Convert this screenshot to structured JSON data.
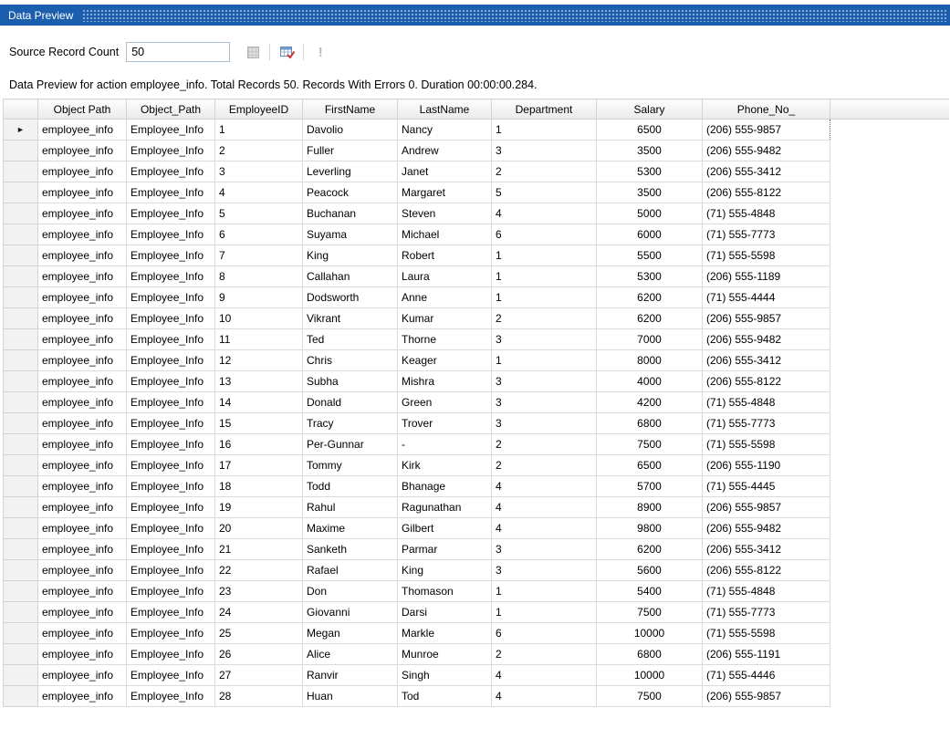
{
  "colors": {
    "titlebar": "#1b5eae",
    "grid_line": "#dcdcdc",
    "header_fill": "#eaeaea"
  },
  "panel": {
    "title": "Data Preview"
  },
  "toolbar": {
    "source_record_count_label": "Source Record Count",
    "source_record_count_value": "50"
  },
  "icons": {
    "current_row_marker": "►",
    "errors_glyph": "!"
  },
  "status": {
    "text": "Data Preview for action employee_info. Total Records 50. Records With Errors 0. Duration 00:00:00.284."
  },
  "table": {
    "columns": [
      "Object Path",
      "Object_Path",
      "EmployeeID",
      "FirstName",
      "LastName",
      "Department",
      "Salary",
      "Phone_No_"
    ],
    "rows": [
      [
        "employee_info",
        "Employee_Info",
        "1",
        "Davolio",
        "Nancy",
        "1",
        "6500",
        "(206) 555-9857"
      ],
      [
        "employee_info",
        "Employee_Info",
        "2",
        "Fuller",
        "Andrew",
        "3",
        "3500",
        "(206) 555-9482"
      ],
      [
        "employee_info",
        "Employee_Info",
        "3",
        "Leverling",
        "Janet",
        "2",
        "5300",
        "(206) 555-3412"
      ],
      [
        "employee_info",
        "Employee_Info",
        "4",
        "Peacock",
        "Margaret",
        "5",
        "3500",
        "(206) 555-8122"
      ],
      [
        "employee_info",
        "Employee_Info",
        "5",
        "Buchanan",
        "Steven",
        "4",
        "5000",
        "(71) 555-4848"
      ],
      [
        "employee_info",
        "Employee_Info",
        "6",
        "Suyama",
        "Michael",
        "6",
        "6000",
        "(71) 555-7773"
      ],
      [
        "employee_info",
        "Employee_Info",
        "7",
        "King",
        "Robert",
        "1",
        "5500",
        "(71) 555-5598"
      ],
      [
        "employee_info",
        "Employee_Info",
        "8",
        "Callahan",
        "Laura",
        "1",
        "5300",
        "(206) 555-1189"
      ],
      [
        "employee_info",
        "Employee_Info",
        "9",
        "Dodsworth",
        "Anne",
        "1",
        "6200",
        "(71) 555-4444"
      ],
      [
        "employee_info",
        "Employee_Info",
        "10",
        "Vikrant",
        "Kumar",
        "2",
        "6200",
        "(206) 555-9857"
      ],
      [
        "employee_info",
        "Employee_Info",
        "11",
        "Ted",
        "Thorne",
        "3",
        "7000",
        "(206) 555-9482"
      ],
      [
        "employee_info",
        "Employee_Info",
        "12",
        "Chris",
        "Keager",
        "1",
        "8000",
        "(206) 555-3412"
      ],
      [
        "employee_info",
        "Employee_Info",
        "13",
        "Subha",
        "Mishra",
        "3",
        "4000",
        "(206) 555-8122"
      ],
      [
        "employee_info",
        "Employee_Info",
        "14",
        "Donald",
        "Green",
        "3",
        "4200",
        "(71) 555-4848"
      ],
      [
        "employee_info",
        "Employee_Info",
        "15",
        "Tracy",
        "Trover",
        "3",
        "6800",
        "(71) 555-7773"
      ],
      [
        "employee_info",
        "Employee_Info",
        "16",
        "Per-Gunnar",
        "-",
        "2",
        "7500",
        "(71) 555-5598"
      ],
      [
        "employee_info",
        "Employee_Info",
        "17",
        "Tommy",
        "Kirk",
        "2",
        "6500",
        "(206) 555-1190"
      ],
      [
        "employee_info",
        "Employee_Info",
        "18",
        "Todd",
        "Bhanage",
        "4",
        "5700",
        "(71) 555-4445"
      ],
      [
        "employee_info",
        "Employee_Info",
        "19",
        "Rahul",
        "Ragunathan",
        "4",
        "8900",
        "(206) 555-9857"
      ],
      [
        "employee_info",
        "Employee_Info",
        "20",
        "Maxime",
        "Gilbert",
        "4",
        "9800",
        "(206) 555-9482"
      ],
      [
        "employee_info",
        "Employee_Info",
        "21",
        "Sanketh",
        "Parmar",
        "3",
        "6200",
        "(206) 555-3412"
      ],
      [
        "employee_info",
        "Employee_Info",
        "22",
        "Rafael",
        "King",
        "3",
        "5600",
        "(206) 555-8122"
      ],
      [
        "employee_info",
        "Employee_Info",
        "23",
        "Don",
        "Thomason",
        "1",
        "5400",
        "(71) 555-4848"
      ],
      [
        "employee_info",
        "Employee_Info",
        "24",
        "Giovanni",
        "Darsi",
        "1",
        "7500",
        "(71) 555-7773"
      ],
      [
        "employee_info",
        "Employee_Info",
        "25",
        "Megan",
        "Markle",
        "6",
        "10000",
        "(71) 555-5598"
      ],
      [
        "employee_info",
        "Employee_Info",
        "26",
        "Alice",
        "Munroe",
        "2",
        "6800",
        "(206) 555-1191"
      ],
      [
        "employee_info",
        "Employee_Info",
        "27",
        "Ranvir",
        "Singh",
        "4",
        "10000",
        "(71) 555-4446"
      ],
      [
        "employee_info",
        "Employee_Info",
        "28",
        "Huan",
        "Tod",
        "4",
        "7500",
        "(206) 555-9857"
      ]
    ]
  }
}
